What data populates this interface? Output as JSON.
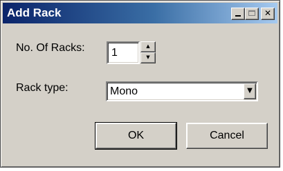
{
  "window": {
    "title": "Add Rack",
    "controls": {
      "minimize_icon": "minimize-icon",
      "maximize_icon": "maximize-icon",
      "close_glyph": "✕"
    }
  },
  "form": {
    "racks_label": "No. Of Racks:",
    "racks_value": "1",
    "spin_up_glyph": "▲",
    "spin_down_glyph": "▼",
    "type_label": "Rack type:",
    "type_value": "Mono",
    "dropdown_glyph": "▼"
  },
  "buttons": {
    "ok_label": "OK",
    "cancel_label": "Cancel"
  },
  "colors": {
    "title_start": "#0a246a",
    "title_end": "#a6caf0",
    "face": "#d4d0c8"
  }
}
